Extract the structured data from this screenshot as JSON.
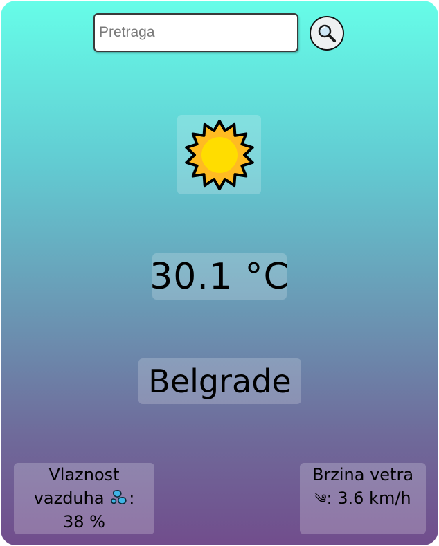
{
  "search": {
    "placeholder": "Pretraga",
    "value": "",
    "button_icon": "magnifier-icon"
  },
  "weather": {
    "icon": "sun-icon",
    "temperature": "30.1 °C",
    "city": "Belgrade"
  },
  "humidity": {
    "label_line1": "Vlaznost",
    "label_line2": "vazduha",
    "icon": "droplets-icon",
    "colon": ":",
    "value": "38 %"
  },
  "wind": {
    "label": "Brzina vetra",
    "icon": "wind-icon",
    "icon_glyph": "༄",
    "value": ": 3.6 km/h"
  },
  "colors": {
    "gradient_top": "#66fde8",
    "gradient_bottom": "#714d8c",
    "sun_fill": "#ffdd00",
    "sun_rays": "#ffbb22"
  }
}
